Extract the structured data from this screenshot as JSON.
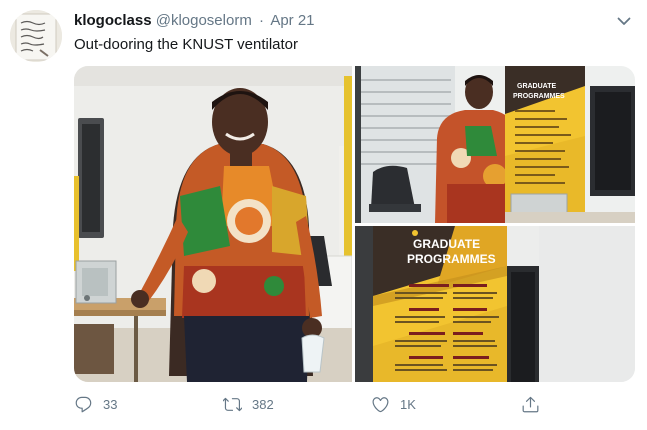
{
  "tweet": {
    "display_name": "klogoclass",
    "handle": "@klogoselorm",
    "separator": "·",
    "date": "Apr 21",
    "text": "Out-dooring the KNUST ventilator"
  },
  "poster": {
    "title": "GRADUATE",
    "subtitle": "PROGRAMMES"
  },
  "actions": {
    "reply_count": "33",
    "retweet_count": "382",
    "like_count": "1K"
  },
  "colors": {
    "text_primary": "#14171a",
    "text_secondary": "#657786",
    "poster_yellow": "#f2c430",
    "poster_dark": "#3a2e26"
  },
  "icons": [
    "chevron-down-icon",
    "reply-icon",
    "retweet-icon",
    "like-icon",
    "share-icon"
  ]
}
